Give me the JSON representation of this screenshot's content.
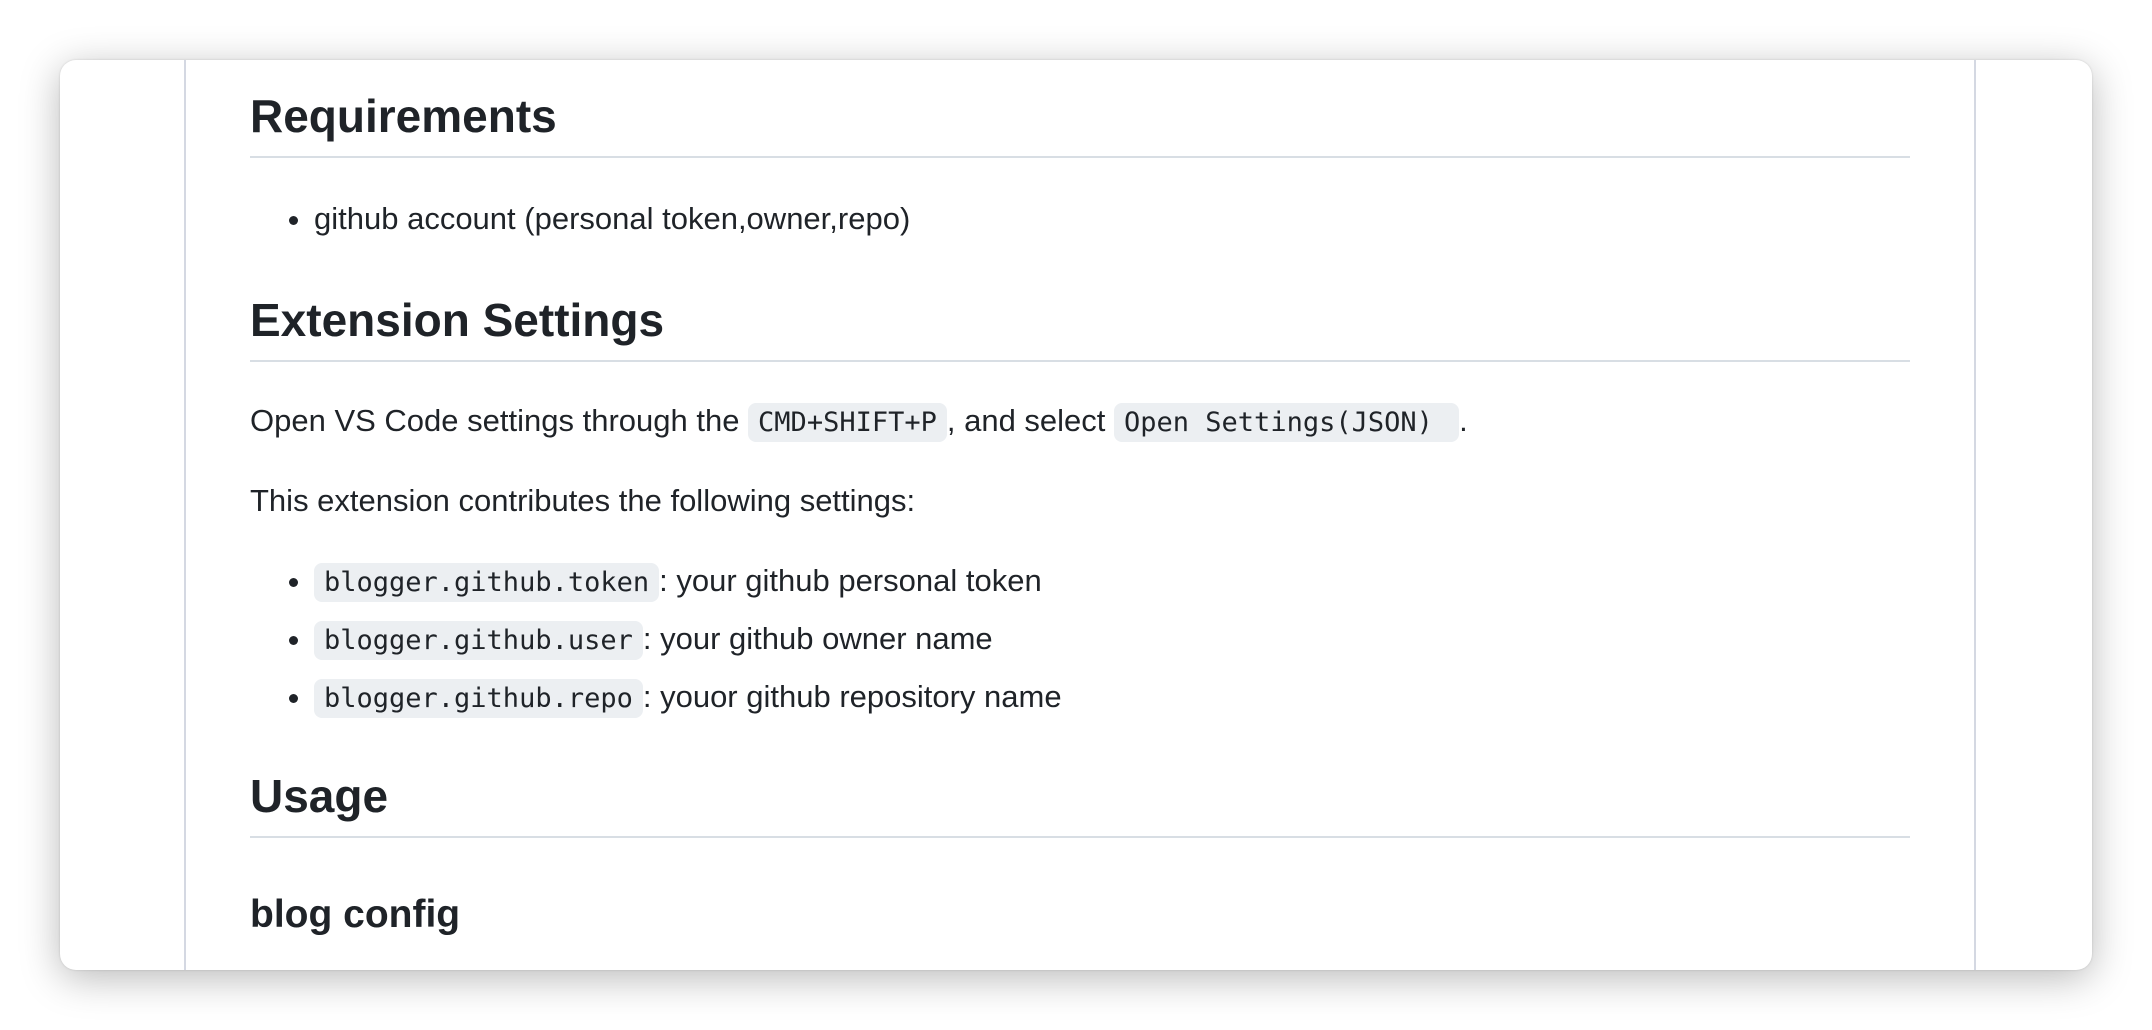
{
  "requirements": {
    "heading": "Requirements",
    "items": [
      "github account (personal token,owner,repo)"
    ]
  },
  "extension_settings": {
    "heading": "Extension Settings",
    "open_text_before": "Open VS Code settings through the ",
    "open_shortcut": "CMD+SHIFT+P",
    "open_text_middle": ", and select ",
    "open_command": "Open Settings(JSON) ",
    "open_text_after": ".",
    "contrib_text": "This extension contributes the following settings:",
    "settings": [
      {
        "key": "blogger.github.token",
        "desc": ": your github personal token"
      },
      {
        "key": "blogger.github.user",
        "desc": ": your github owner name"
      },
      {
        "key": "blogger.github.repo",
        "desc": ": youor github repository name"
      }
    ]
  },
  "usage": {
    "heading": "Usage",
    "subheading": "blog config"
  }
}
